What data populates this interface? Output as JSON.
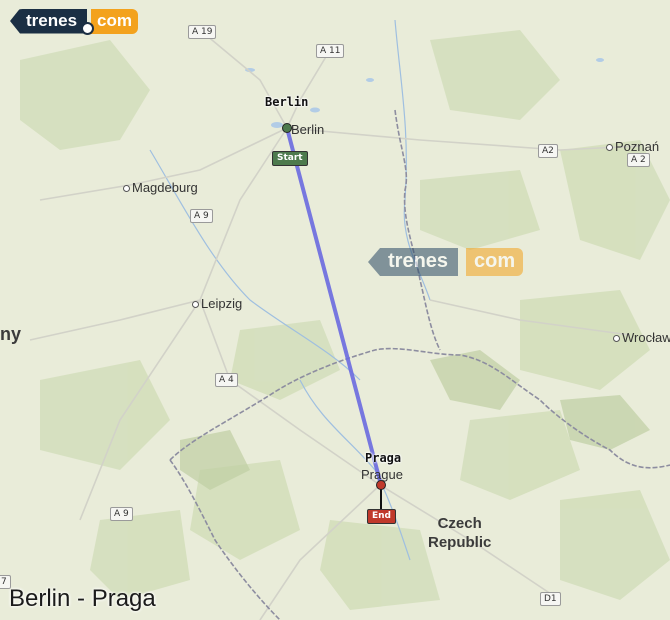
{
  "logo": {
    "left": "trenes",
    "right": "com"
  },
  "watermark": {
    "left": "trenes",
    "right": "com"
  },
  "title": "Berlin - Praga",
  "route": {
    "origin": "Berlin",
    "destination": "Praga",
    "color": "#6b6be0"
  },
  "stations": {
    "origin_label": "Berlin",
    "destination_label": "Praga",
    "start_tag": "Start",
    "end_tag": "End",
    "start_color": "#4d7a4d",
    "end_color": "#c0392b"
  },
  "cities": {
    "berlin": "Berlin",
    "magdeburg": "Magdeburg",
    "leipzig": "Leipzig",
    "poznan": "Poznań",
    "wroclaw": "Wrocław",
    "prague": "Prague"
  },
  "country_label": {
    "line1": "Czech",
    "line2": "Republic"
  },
  "edge_label": "ny",
  "edge_number": "7",
  "roads": {
    "a19": "A 19",
    "a11": "A 11",
    "a2_pl": "A2",
    "a2_de": "A 2",
    "a9_north": "A 9",
    "a4": "A 4",
    "a9_south": "A 9",
    "d1": "D1"
  },
  "colors": {
    "land": "#e9ecd9",
    "forest": "#cfdcb4",
    "water": "#a9c6e4",
    "border": "#8a8a9a",
    "road": "#c8c8c0"
  }
}
